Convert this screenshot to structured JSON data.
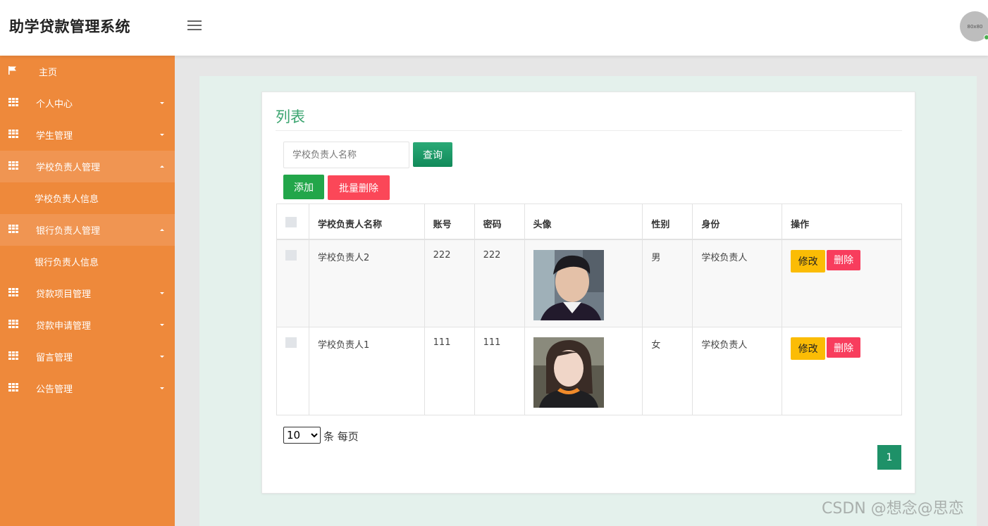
{
  "header": {
    "app_title": "助学贷款管理系统",
    "avatar_text": "80x80"
  },
  "sidebar": {
    "items": [
      {
        "label": "主页"
      },
      {
        "label": "个人中心"
      },
      {
        "label": "学生管理"
      },
      {
        "label": "学校负责人管理"
      },
      {
        "label": "学校负责人信息"
      },
      {
        "label": "银行负责人管理"
      },
      {
        "label": "银行负责人信息"
      },
      {
        "label": "贷款项目管理"
      },
      {
        "label": "贷款申请管理"
      },
      {
        "label": "留言管理"
      },
      {
        "label": "公告管理"
      }
    ]
  },
  "main": {
    "title": "列表",
    "search": {
      "placeholder": "学校负责人名称",
      "value": ""
    },
    "query_label": "查询",
    "add_label": "添加",
    "batch_delete_label": "批量删除",
    "table": {
      "headers": [
        "学校负责人名称",
        "账号",
        "密码",
        "头像",
        "性别",
        "身份",
        "操作"
      ],
      "rows": [
        {
          "name": "学校负责人2",
          "account": "222",
          "password": "222",
          "gender": "男",
          "role": "学校负责人"
        },
        {
          "name": "学校负责人1",
          "account": "111",
          "password": "111",
          "gender": "女",
          "role": "学校负责人"
        }
      ],
      "edit_label": "修改",
      "delete_label": "删除"
    },
    "pagination": {
      "page_size": "10",
      "page_size_suffix": "条 每页",
      "current_page": "1"
    }
  },
  "watermark": "CSDN @想念@思恋"
}
